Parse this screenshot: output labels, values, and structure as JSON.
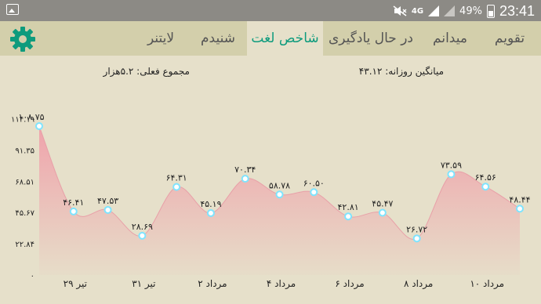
{
  "status_bar": {
    "time": "23:41",
    "battery": "49%",
    "network": "4G",
    "icons": [
      "gallery-icon",
      "mute-icon",
      "signal-icon",
      "battery-icon"
    ]
  },
  "tabs": [
    {
      "label": "تقویم",
      "active": false
    },
    {
      "label": "میدانم",
      "active": false
    },
    {
      "label": "در حال یادگیری",
      "active": false
    },
    {
      "label": "شاخص لغت",
      "active": true
    },
    {
      "label": "شنیدم",
      "active": false
    },
    {
      "label": "لایتنر",
      "active": false
    }
  ],
  "settings_icon": "gear-icon",
  "summary": {
    "total": "مجموع فعلی: ۵.۲هزار",
    "daily_average": "میانگین روزانه: ۴۳.۱۲"
  },
  "colors": {
    "accent": "#0e9b7d",
    "area_fill": "#f0a8b0",
    "point": "#7fe4ff",
    "tab_bar": "#d3cfab",
    "background": "#e6e0ca"
  },
  "chart_data": {
    "type": "area",
    "y_ticks": [
      "۰",
      "۲۲.۸۴",
      "۴۵.۶۷",
      "۶۸.۵۱",
      "۹۱.۳۵",
      "۱۱۴.۱۹"
    ],
    "ylim": [
      0,
      114.19
    ],
    "x_tick_labels": [
      "۲۹ تیر",
      "۳۱ تیر",
      "۲ مرداد",
      "۴ مرداد",
      "۶ مرداد",
      "۸ مرداد",
      "۱۰ مرداد"
    ],
    "values": [
      108.75,
      46.41,
      47.53,
      28.69,
      64.31,
      45.19,
      70.34,
      58.78,
      60.5,
      42.81,
      45.47,
      26.72,
      73.59,
      64.56,
      48.44
    ],
    "data_labels": [
      "۱۰۸.۷۵",
      "۴۶.۴۱",
      "۴۷.۵۳",
      "۲۸.۶۹",
      "۶۴.۳۱",
      "۴۵.۱۹",
      "۷۰.۳۴",
      "۵۸.۷۸",
      "۶۰.۵۰",
      "۴۲.۸۱",
      "۴۵.۴۷",
      "۲۶.۷۲",
      "۷۳.۵۹",
      "۶۴.۵۶",
      "۴۸.۴۴"
    ],
    "grid": false
  }
}
